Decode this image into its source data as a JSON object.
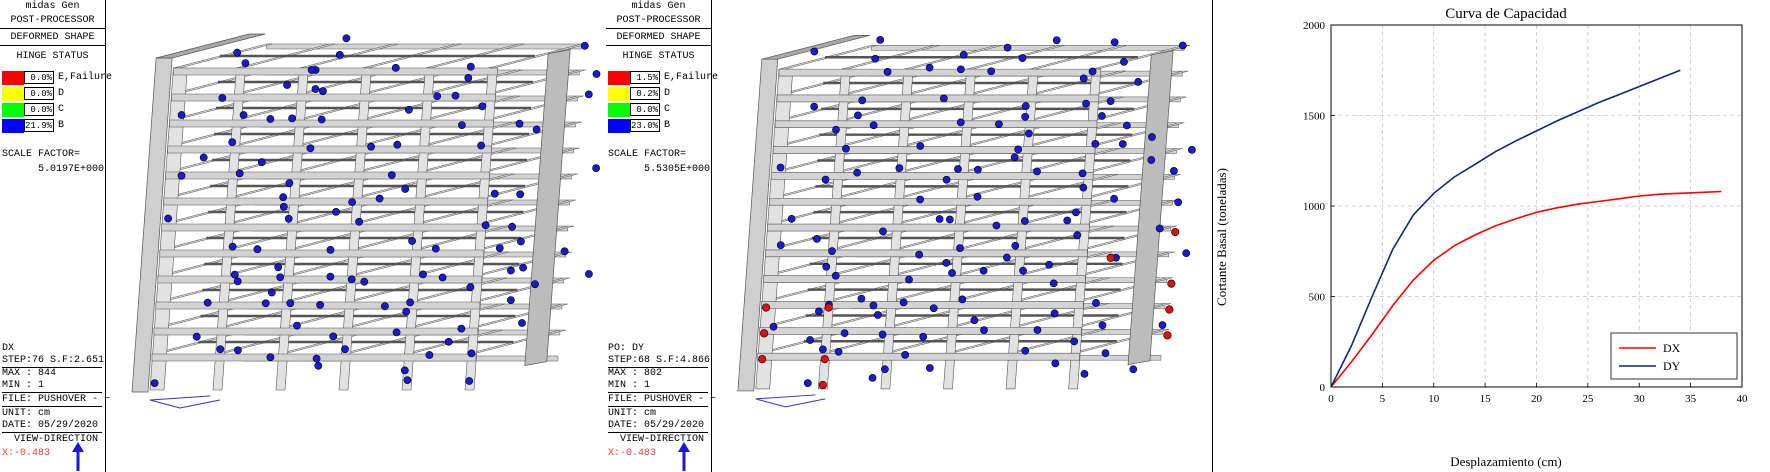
{
  "panels": [
    {
      "app": "midas Gen",
      "module": "POST-PROCESSOR",
      "mode": "DEFORMED SHAPE",
      "status_title": "HINGE STATUS",
      "legend": [
        {
          "pct": "0.0%",
          "label": "E,Failure",
          "color": "#ff0000"
        },
        {
          "pct": "0.0%",
          "label": "D",
          "color": "#ffff00"
        },
        {
          "pct": "0.0%",
          "label": "C",
          "color": "#00ff00"
        },
        {
          "pct": "21.9%",
          "label": "B",
          "color": "#0000ff"
        }
      ],
      "scale_label": "SCALE FACTOR=",
      "scale_value": "5.0197E+000",
      "load_case": "DX",
      "step": "STEP:76 S.F:2.651",
      "max": "MAX : 844",
      "min": "MIN : 1",
      "file": "FILE: PUSHOVER - ~",
      "unit": "UNIT: cm",
      "date": "DATE: 05/29/2020",
      "view_dir": "VIEW-DIRECTION",
      "coord": "X:-0.483",
      "hinge_color": "#1a1ad0"
    },
    {
      "app": "midas Gen",
      "module": "POST-PROCESSOR",
      "mode": "DEFORMED SHAPE",
      "status_title": "HINGE STATUS",
      "legend": [
        {
          "pct": "1.5%",
          "label": "E,Failure",
          "color": "#ff0000"
        },
        {
          "pct": "0.2%",
          "label": "D",
          "color": "#ffff00"
        },
        {
          "pct": "0.0%",
          "label": "C",
          "color": "#00ff00"
        },
        {
          "pct": "23.0%",
          "label": "B",
          "color": "#0000ff"
        }
      ],
      "scale_label": "SCALE FACTOR=",
      "scale_value": "5.5305E+000",
      "load_case": "PO: DY",
      "step": "STEP:68 S.F:4.866",
      "max": "MAX : 802",
      "min": "MIN : 1",
      "file": "FILE: PUSHOVER - ~",
      "unit": "UNIT: cm",
      "date": "DATE: 05/29/2020",
      "view_dir": "VIEW-DIRECTION",
      "coord": "X:-0.483",
      "hinge_color": "#1a1ad0",
      "failure_color": "#e01010"
    }
  ],
  "chart_data": {
    "type": "line",
    "title": "Curva de Capacidad",
    "xlabel": "Desplazamiento (cm)",
    "ylabel": "Cortante Basal (toneladas)",
    "xlim": [
      0,
      40
    ],
    "ylim": [
      0,
      2000
    ],
    "xticks": [
      0,
      5,
      10,
      15,
      20,
      25,
      30,
      35,
      40
    ],
    "yticks": [
      0,
      500,
      1000,
      1500,
      2000
    ],
    "grid": true,
    "legend_position": "bottom-right",
    "series": [
      {
        "name": "DX",
        "color": "#ff0000",
        "x": [
          0,
          2,
          4,
          6,
          8,
          10,
          12,
          14,
          16,
          18,
          20,
          22,
          24,
          26,
          28,
          30,
          32,
          34,
          36,
          38
        ],
        "y": [
          0,
          140,
          290,
          450,
          590,
          700,
          780,
          840,
          890,
          930,
          965,
          990,
          1010,
          1025,
          1040,
          1055,
          1065,
          1070,
          1075,
          1080
        ]
      },
      {
        "name": "DY",
        "color": "#0d2a6b",
        "x": [
          0,
          2,
          4,
          6,
          8,
          10,
          12,
          14,
          16,
          18,
          20,
          22,
          24,
          26,
          28,
          30,
          32,
          34
        ],
        "y": [
          0,
          230,
          500,
          760,
          950,
          1070,
          1160,
          1230,
          1300,
          1360,
          1415,
          1470,
          1520,
          1570,
          1615,
          1660,
          1705,
          1750
        ]
      }
    ]
  }
}
